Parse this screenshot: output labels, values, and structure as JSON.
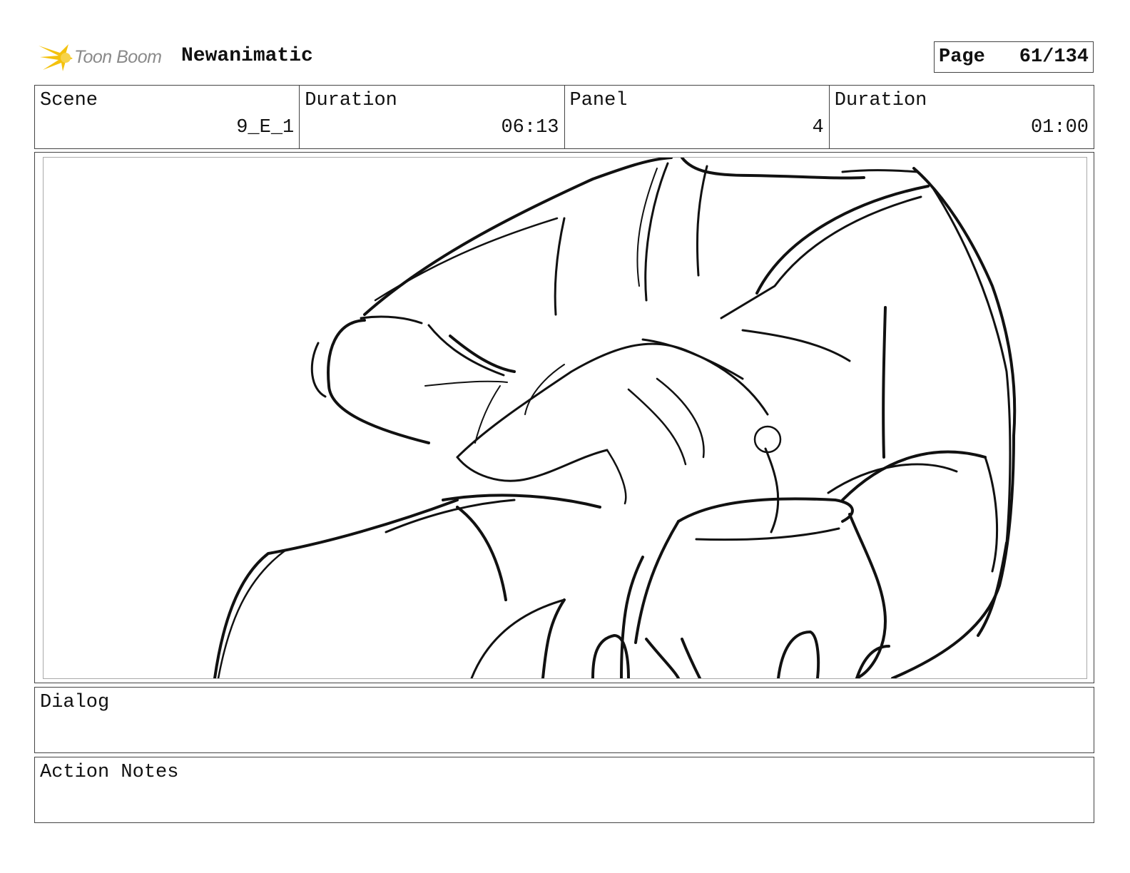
{
  "header": {
    "brand": "Toon Boom",
    "project_title": "Newanimatic",
    "page_label": "Page",
    "page_value": "61/134"
  },
  "info": {
    "scene_label": "Scene",
    "scene_value": "9_E_1",
    "scene_duration_label": "Duration",
    "scene_duration_value": "06:13",
    "panel_label": "Panel",
    "panel_value": "4",
    "panel_duration_label": "Duration",
    "panel_duration_value": "01:00"
  },
  "panel_image": {
    "icon": "storyboard-sketch",
    "colors": {
      "ink": "#111111",
      "frame": "#444444",
      "inner_frame": "#aaaaaa",
      "logo": "#f4c20d"
    }
  },
  "dialog": {
    "label": "Dialog",
    "text": ""
  },
  "action_notes": {
    "label": "Action Notes",
    "text": ""
  }
}
